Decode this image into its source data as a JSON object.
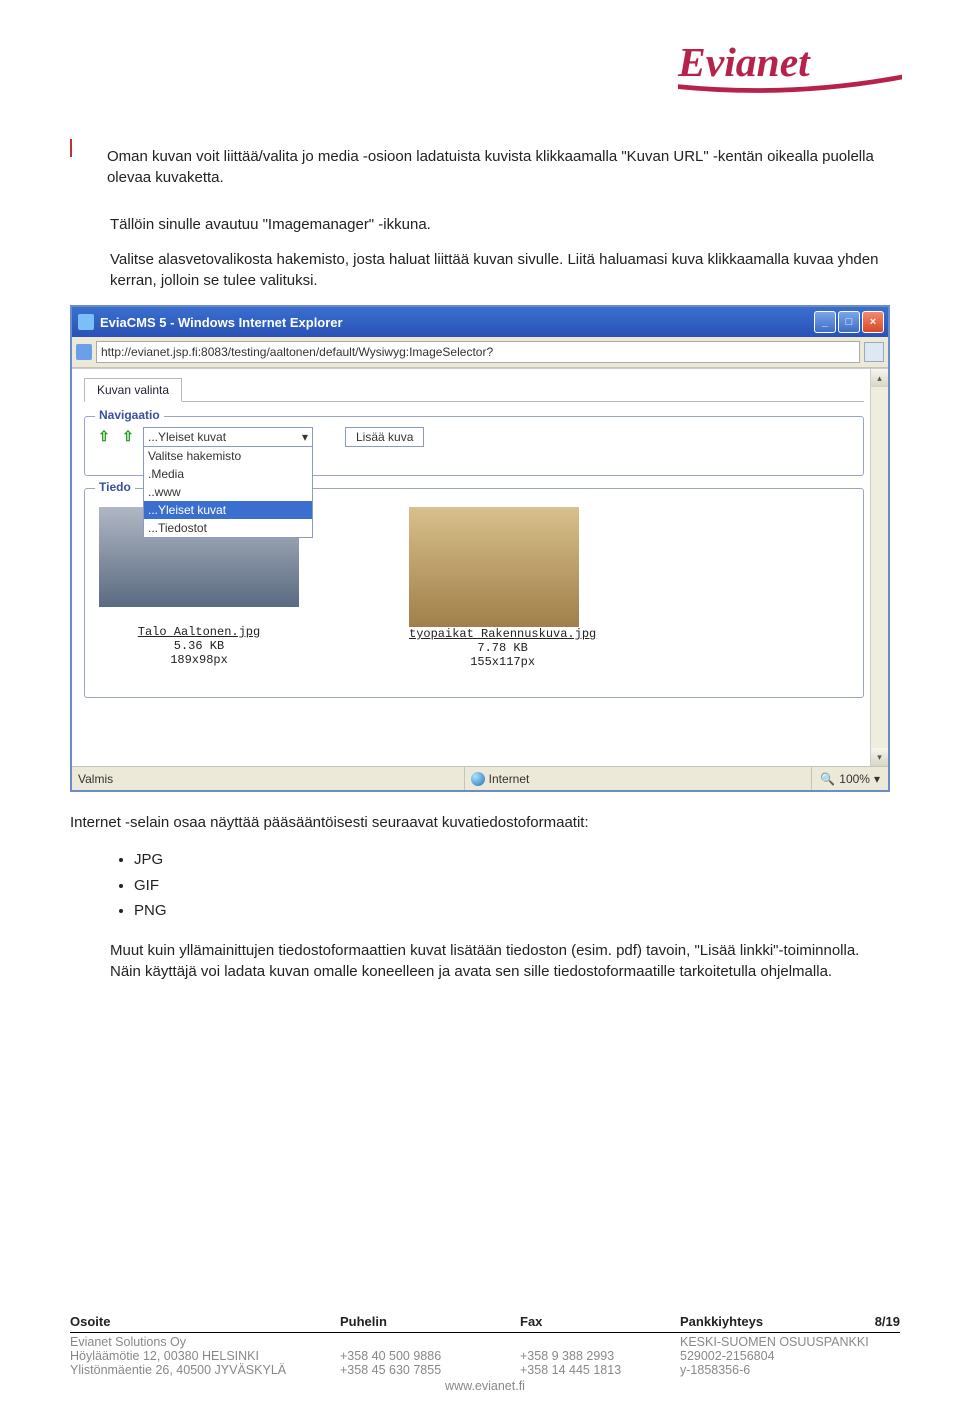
{
  "logo_text": "Evianet",
  "main": {
    "intro_line1": "Oman kuvan voit liittää/valita jo media -osioon ladatuista kuvista klikkaamalla \"Kuvan URL\" -kentän oikealla puolella olevaa kuvaketta.",
    "para2": "Tällöin sinulle avautuu \"Imagemanager\" -ikkuna.",
    "para3": "Valitse alasvetovalikosta hakemisto, josta haluat liittää kuvan sivulle. Liitä haluamasi kuva klikkaamalla kuvaa yhden kerran, jolloin se tulee valituksi."
  },
  "ie": {
    "title": "EviaCMS 5 - Windows Internet Explorer",
    "url": "http://evianet.jsp.fi:8083/testing/aaltonen/default/Wysiwyg:ImageSelector?",
    "tab": "Kuvan valinta",
    "nav_legend": "Navigaatio",
    "files_legend": "Tiedo",
    "combo_selected": "...Yleiset kuvat",
    "dropdown": [
      "Valitse hakemisto",
      ".Media",
      "..www",
      "...Yleiset kuvat",
      "...Tiedostot"
    ],
    "add_btn": "Lisää kuva",
    "thumb_a": {
      "name": "Talo Aaltonen.jpg",
      "size": "5.36 KB",
      "dim": "189x98px"
    },
    "thumb_b": {
      "name": "tyopaikat Rakennuskuva.jpg",
      "size": "7.78 KB",
      "dim": "155x117px"
    },
    "status_left": "Valmis",
    "status_mid": "Internet",
    "status_zoom": "100%"
  },
  "after": {
    "formats_intro": "Internet -selain osaa näyttää pääsääntöisesti seuraavat kuvatiedostoformaatit:",
    "formats": [
      "JPG",
      "GIF",
      "PNG"
    ],
    "closing": "Muut kuin yllämainittujen tiedostoformaattien kuvat lisätään tiedoston (esim. pdf) tavoin, \"Lisää linkki\"-toiminnolla. Näin käyttäjä voi ladata kuvan omalle koneelleen ja avata sen sille tiedostoformaatille tarkoitetulla ohjelmalla."
  },
  "footer": {
    "h1": "Osoite",
    "h2": "Puhelin",
    "h3": "Fax",
    "h4": "Pankkiyhteys",
    "page": "8/19",
    "c1a": "Evianet Solutions Oy",
    "c1b": "Höyläämötie 12, 00380 HELSINKI",
    "c1c": "Ylistönmäentie 26, 40500 JYVÄSKYLÄ",
    "c2b": "+358 40 500 9886",
    "c2c": "+358 45 630 7855",
    "c3b": "+358 9 388 2993",
    "c3c": "+358 14 445 1813",
    "c4a": "KESKI-SUOMEN OSUUSPANKKI",
    "c4b": "529002-2156804",
    "c4c": "y-1858356-6",
    "www": "www.evianet.fi"
  }
}
